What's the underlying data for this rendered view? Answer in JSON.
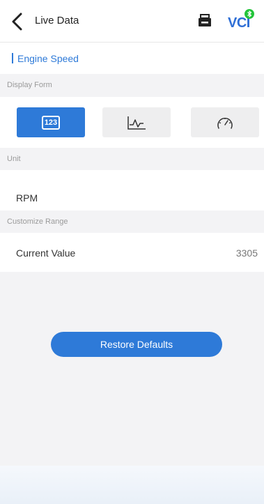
{
  "header": {
    "title": "Live Data",
    "vci_label": "VCI",
    "back_icon": "chevron-left-icon",
    "print_icon": "print-icon",
    "bluetooth_icon": "bluetooth-icon",
    "bluetooth_status_color": "#23c43a"
  },
  "section": {
    "title": "Engine Speed",
    "accent_color": "#2e7ad8"
  },
  "display_form": {
    "label": "Display Form",
    "options": [
      {
        "name": "digital",
        "icon": "number-123-icon",
        "text": "123",
        "selected": true
      },
      {
        "name": "graph",
        "icon": "line-chart-icon",
        "selected": false
      },
      {
        "name": "gauge",
        "icon": "gauge-icon",
        "selected": false
      }
    ]
  },
  "unit": {
    "label": "Unit",
    "value": "RPM"
  },
  "customize_range": {
    "label": "Customize Range",
    "current_value_label": "Current Value",
    "current_value": "3305"
  },
  "actions": {
    "restore_defaults": "Restore Defaults"
  }
}
